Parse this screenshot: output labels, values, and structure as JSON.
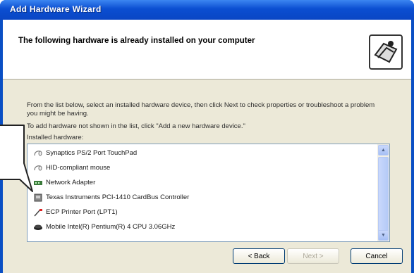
{
  "window": {
    "title": "Add Hardware Wizard"
  },
  "header": {
    "title": "The following hardware is already installed on your computer",
    "icon": "hardware-wizard-icon"
  },
  "body": {
    "description": "From the list below, select an installed hardware device, then click Next to check properties or troubleshoot a problem you might be having.",
    "add_hint": "To add hardware not shown in the list, click \"Add a new hardware device.\"",
    "list_label": "Installed hardware:"
  },
  "hardware_list": [
    {
      "label": "Synaptics PS/2 Port TouchPad",
      "icon": "mouse-icon"
    },
    {
      "label": "HID-compliant mouse",
      "icon": "mouse-icon"
    },
    {
      "label": "Network Adapter",
      "icon": "network-adapter-icon"
    },
    {
      "label": "Texas Instruments PCI-1410 CardBus Controller",
      "icon": "pcmcia-icon"
    },
    {
      "label": "ECP Printer Port (LPT1)",
      "icon": "printer-port-icon"
    },
    {
      "label": "Mobile Intel(R) Pentium(R) 4     CPU 3.06GHz",
      "icon": "processor-icon"
    }
  ],
  "buttons": {
    "back": "< Back",
    "next": "Next >",
    "cancel": "Cancel"
  },
  "colors": {
    "titlebar": "#0a4fc4",
    "client": "#ece9d8"
  }
}
